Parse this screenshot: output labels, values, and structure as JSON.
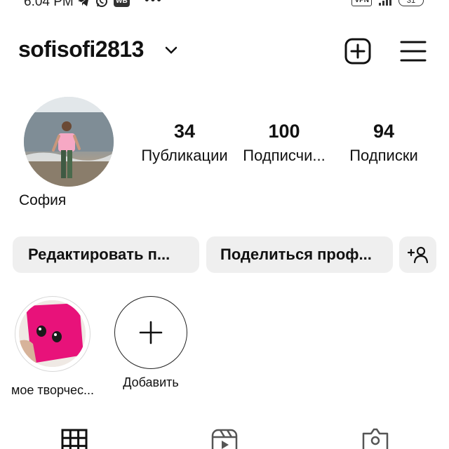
{
  "status_bar": {
    "time": "6:04 PM",
    "wb_badge": "WB",
    "dots": "•••",
    "vpn": "VPN",
    "battery": "31",
    "icons": [
      "telegram-icon",
      "whatsapp-icon",
      "wb-icon",
      "vpn-icon",
      "signal-icon",
      "battery-icon"
    ]
  },
  "header": {
    "username": "sofisofi2813",
    "icons": [
      "chevron-down-icon",
      "add-post-icon",
      "menu-icon"
    ]
  },
  "profile": {
    "display_name": "София",
    "stats": [
      {
        "value": "34",
        "label": "Публикации"
      },
      {
        "value": "100",
        "label": "Подписчи..."
      },
      {
        "value": "94",
        "label": "Подписки"
      }
    ]
  },
  "actions": {
    "edit_label": "Редактировать п...",
    "share_label": "Поделиться проф...",
    "discover_icon": "add-person-icon"
  },
  "highlights": [
    {
      "label": "мое творчес..."
    },
    {
      "label": "Добавить"
    }
  ],
  "tabs": [
    {
      "icon": "grid-icon"
    },
    {
      "icon": "reels-icon"
    },
    {
      "icon": "tagged-icon"
    }
  ],
  "colors": {
    "background": "#ffffff",
    "button_bg": "#efefef",
    "text": "#111111",
    "highlight_pink": "#e8127a"
  }
}
